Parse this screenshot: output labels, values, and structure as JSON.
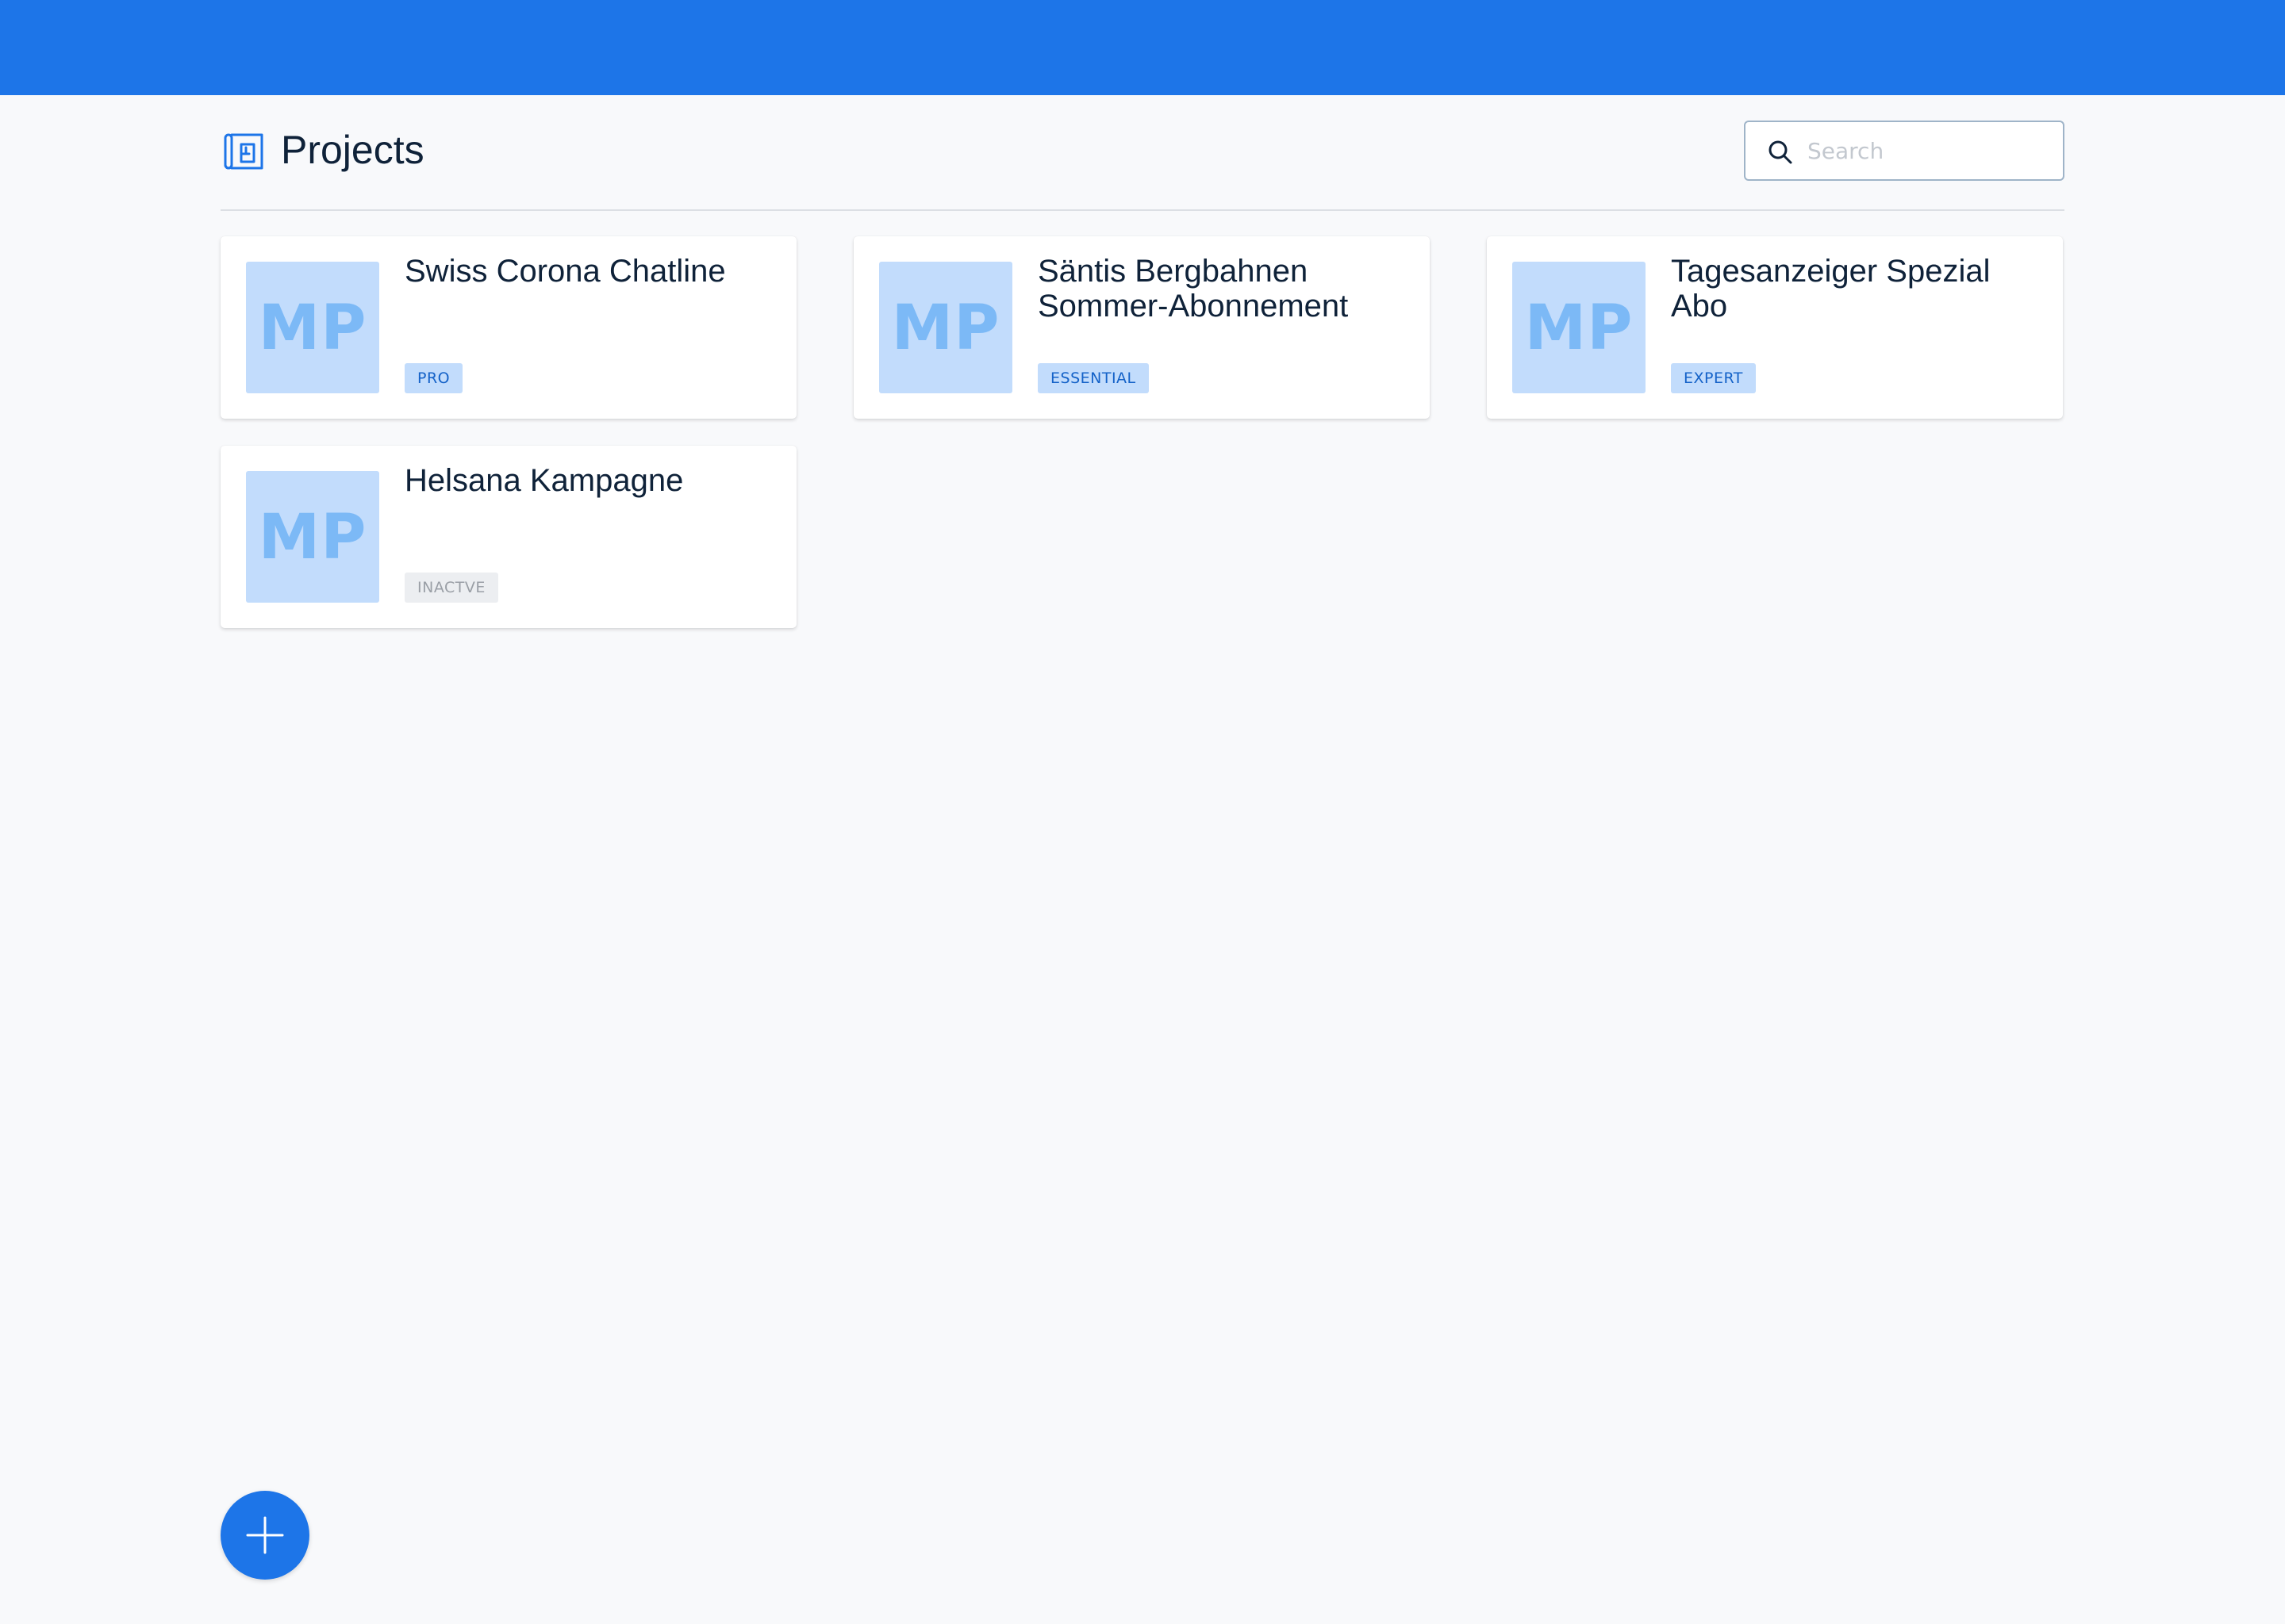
{
  "header": {
    "title": "Projects",
    "icon": "projects-blueprint-icon"
  },
  "search": {
    "placeholder": "Search",
    "value": "",
    "icon": "search-icon"
  },
  "projects": [
    {
      "title": "Swiss Corona Chatline",
      "thumbnail_initials": "MP",
      "plan": "PRO",
      "status": "active"
    },
    {
      "title": "Säntis Bergbahnen Sommer-Abonnement",
      "thumbnail_initials": "MP",
      "plan": "ESSENTIAL",
      "status": "active"
    },
    {
      "title": "Tagesanzeiger Spezial Abo",
      "thumbnail_initials": "MP",
      "plan": "EXPERT",
      "status": "active"
    },
    {
      "title": "Helsana Kampagne",
      "thumbnail_initials": "MP",
      "plan": "INACTVE",
      "status": "inactive"
    }
  ],
  "fab": {
    "icon": "plus-icon"
  },
  "colors": {
    "primary": "#1d75e8",
    "background": "#f8f9fb",
    "thumbnail_bg": "#c2dcfc",
    "thumbnail_text": "#7cb9f6",
    "badge_active_bg": "#c2dcfc",
    "badge_active_text": "#1462c8",
    "badge_inactive_bg": "#eceef1",
    "badge_inactive_text": "#9a9fa6"
  }
}
